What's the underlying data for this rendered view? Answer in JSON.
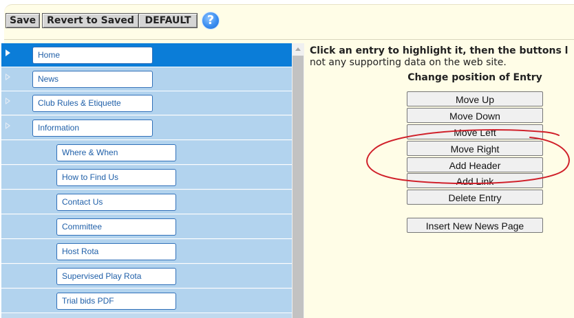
{
  "toolbar": {
    "save_label": "Save",
    "revert_label": "Revert to Saved",
    "default_label": "DEFAULT",
    "help_glyph": "?"
  },
  "tree": {
    "items": [
      {
        "label": "Home",
        "level": 1,
        "selected": true
      },
      {
        "label": "News",
        "level": 1
      },
      {
        "label": "Club Rules & Etiquette",
        "level": 1
      },
      {
        "label": "Information",
        "level": 1
      },
      {
        "label": "Where & When",
        "level": 2
      },
      {
        "label": "How to Find Us",
        "level": 2
      },
      {
        "label": "Contact Us",
        "level": 2
      },
      {
        "label": "Committee",
        "level": 2
      },
      {
        "label": "Host Rota",
        "level": 2
      },
      {
        "label": "Supervised Play Rota",
        "level": 2
      },
      {
        "label": "Trial bids PDF",
        "level": 2
      }
    ]
  },
  "instructions": {
    "line1": "Click an entry to highlight it, then the buttons l",
    "line2": "not any supporting data on the web site."
  },
  "actions": {
    "title": "Change position of Entry",
    "move_up": "Move Up",
    "move_down": "Move Down",
    "move_left": "Move Left",
    "move_right": "Move Right",
    "add_header": "Add Header",
    "add_link": "Add Link",
    "delete_entry": "Delete Entry",
    "insert_news": "Insert New News Page"
  },
  "colors": {
    "selected_row": "#0b7dd8",
    "row": "#b2d3ee",
    "annotation": "#d0202a"
  }
}
